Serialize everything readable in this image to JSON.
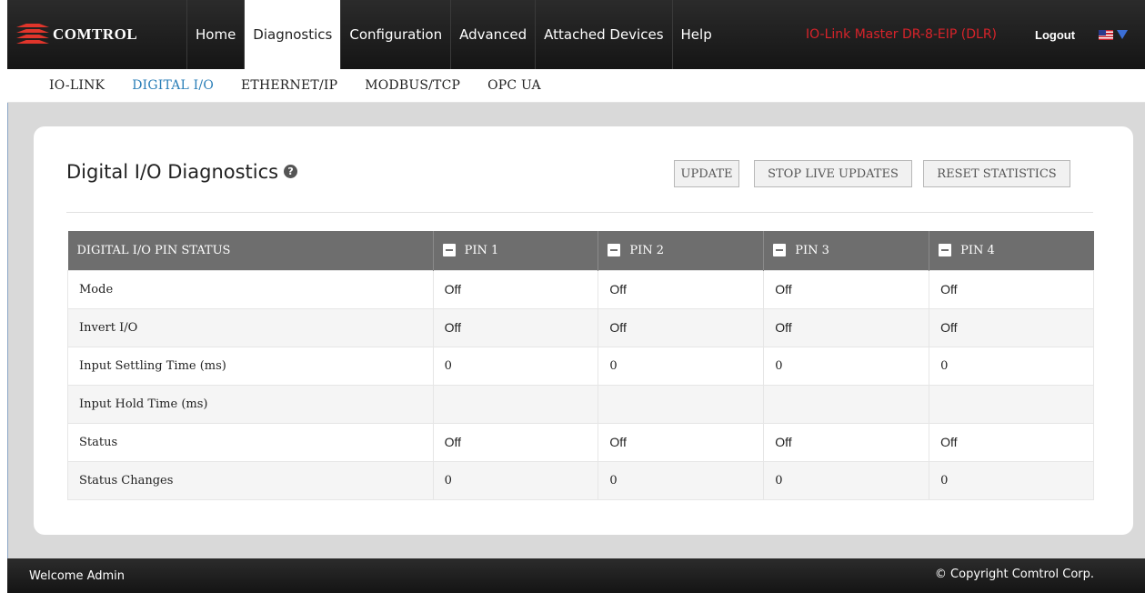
{
  "brand": {
    "name": "COMTROL",
    "accent": "#e0352b"
  },
  "nav": {
    "items": [
      {
        "label": "Home"
      },
      {
        "label": "Diagnostics",
        "active": true
      },
      {
        "label": "Configuration"
      },
      {
        "label": "Advanced"
      },
      {
        "label": "Attached Devices"
      },
      {
        "label": "Help"
      }
    ],
    "device_name": "IO-Link Master DR-8-EIP (DLR)",
    "device_name_color": "#d8232a",
    "logout_label": "Logout",
    "language_icon": "us-flag-icon"
  },
  "subnav": {
    "items": [
      {
        "label": "IO-LINK"
      },
      {
        "label": "DIGITAL I/O",
        "active": true
      },
      {
        "label": "ETHERNET/IP"
      },
      {
        "label": "MODBUS/TCP"
      },
      {
        "label": "OPC UA"
      }
    ]
  },
  "page": {
    "title": "Digital I/O Diagnostics",
    "help_icon": "question-circle-icon",
    "buttons": {
      "update": "UPDATE",
      "stop_live": "STOP LIVE UPDATES",
      "reset_stats": "RESET STATISTICS"
    }
  },
  "table": {
    "headers": [
      "DIGITAL I/O PIN STATUS",
      "PIN 1",
      "PIN 2",
      "PIN 3",
      "PIN 4"
    ],
    "rows": [
      {
        "label": "Mode",
        "values": [
          "Off",
          "Off",
          "Off",
          "Off"
        ]
      },
      {
        "label": "Invert I/O",
        "values": [
          "Off",
          "Off",
          "Off",
          "Off"
        ]
      },
      {
        "label": "Input Settling Time (ms)",
        "values": [
          "0",
          "0",
          "0",
          "0"
        ]
      },
      {
        "label": "Input Hold Time (ms)",
        "values": [
          "",
          "",
          "",
          ""
        ]
      },
      {
        "label": "Status",
        "values": [
          "Off",
          "Off",
          "Off",
          "Off"
        ]
      },
      {
        "label": "Status Changes",
        "values": [
          "0",
          "0",
          "0",
          "0"
        ]
      }
    ]
  },
  "footer": {
    "welcome": "Welcome Admin",
    "copyright": "© Copyright Comtrol Corp."
  }
}
